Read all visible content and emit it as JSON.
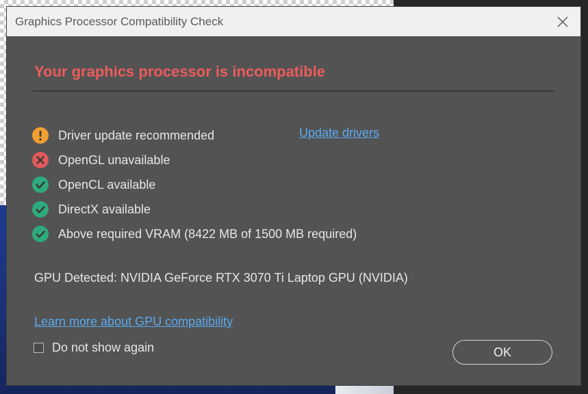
{
  "window": {
    "title": "Graphics Processor Compatibility Check"
  },
  "heading": "Your graphics processor is incompatible",
  "checks": [
    {
      "label": "Driver update recommended",
      "status": "warning",
      "icon": "exclamation-icon",
      "color": "#f0a030"
    },
    {
      "label": "OpenGL unavailable",
      "status": "error",
      "icon": "x-circle-icon",
      "color": "#e05a5a"
    },
    {
      "label": "OpenCL available",
      "status": "ok",
      "icon": "check-circle-icon",
      "color": "#2eaa7d"
    },
    {
      "label": "DirectX available",
      "status": "ok",
      "icon": "check-circle-icon",
      "color": "#2eaa7d"
    },
    {
      "label": "Above required VRAM (8422 MB of 1500 MB required)",
      "status": "ok",
      "icon": "check-circle-icon",
      "color": "#2eaa7d"
    }
  ],
  "update_link": "Update drivers",
  "gpu_detected": "GPU Detected: NVIDIA GeForce RTX 3070 Ti Laptop GPU (NVIDIA)",
  "learn_more_link": "Learn more about GPU compatibility",
  "do_not_show": {
    "label": "Do not show again",
    "checked": false
  },
  "ok_button": "OK",
  "colors": {
    "heading": "#ec5c5c",
    "link": "#5aaaf0",
    "dialog_bg": "#535353"
  }
}
